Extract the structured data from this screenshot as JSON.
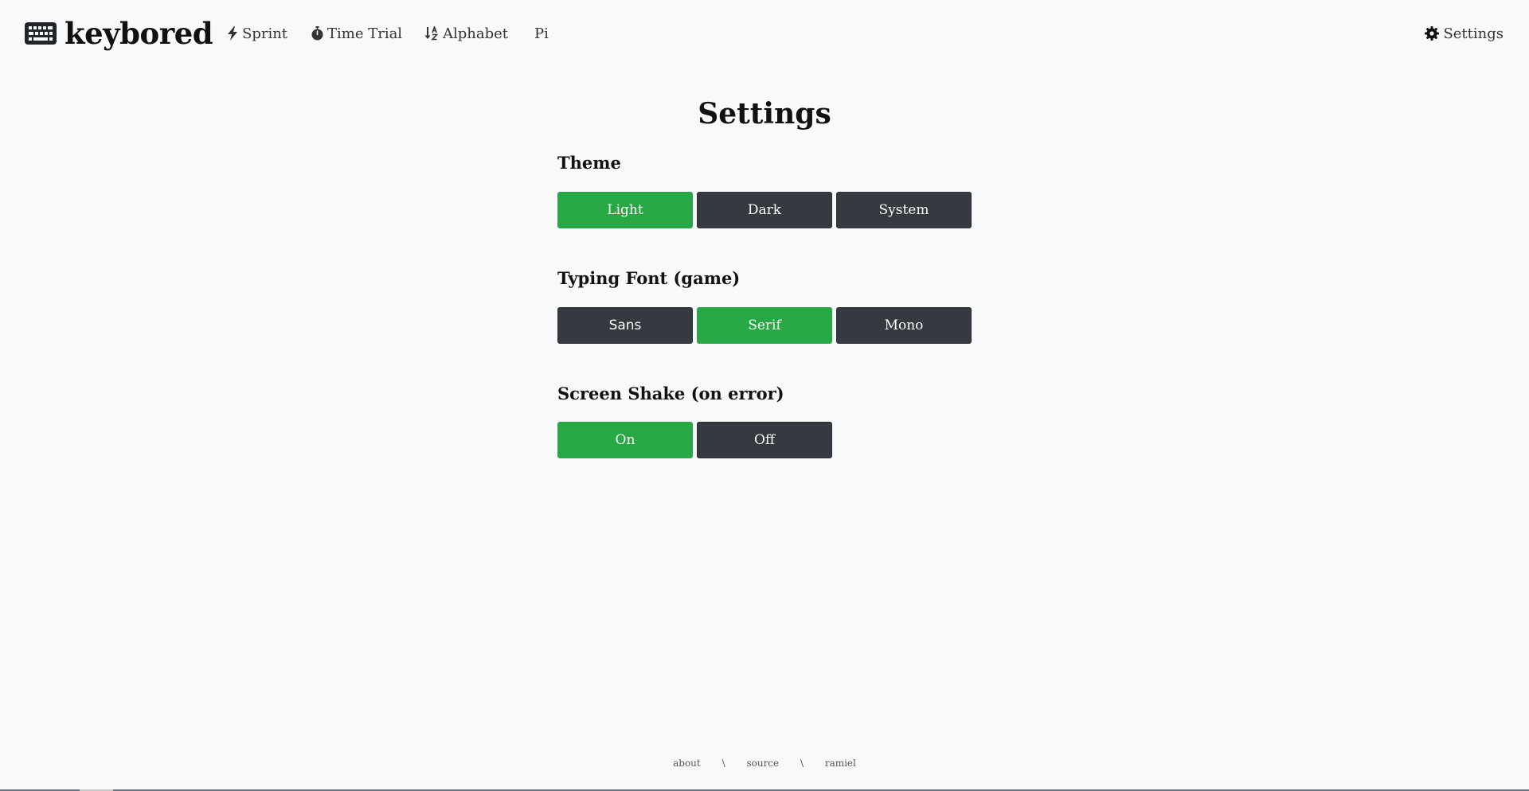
{
  "nav": {
    "brand": "keybored",
    "links": [
      {
        "label": "Sprint",
        "icon": "bolt-icon"
      },
      {
        "label": "Time Trial",
        "icon": "stopwatch-icon"
      },
      {
        "label": "Alphabet",
        "icon": "sort-alpha-down-icon"
      },
      {
        "label": "Pi",
        "icon": ""
      }
    ],
    "settings": {
      "label": "Settings",
      "icon": "gear-icon"
    }
  },
  "page": {
    "title": "Settings"
  },
  "sections": [
    {
      "title": "Theme",
      "options": [
        "Light",
        "Dark",
        "System"
      ],
      "selected": "Light"
    },
    {
      "title": "Typing Font (game)",
      "options": [
        "Sans",
        "Serif",
        "Mono"
      ],
      "selected": "Serif"
    },
    {
      "title": "Screen Shake (on error)",
      "options": [
        "On",
        "Off"
      ],
      "selected": "On"
    }
  ],
  "footer": {
    "links": [
      "about",
      "source",
      "ramiel"
    ],
    "separator": "\\"
  },
  "colors": {
    "background": "#f8f9fa",
    "active": "#28a745",
    "inactive": "#343a40",
    "text": "#111111"
  }
}
